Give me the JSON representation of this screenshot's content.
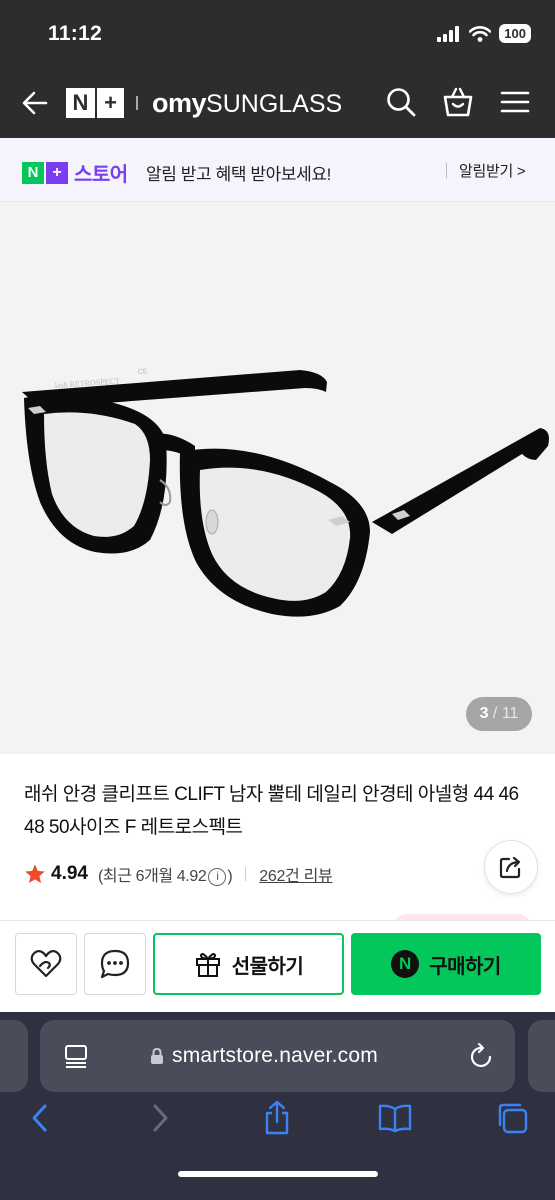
{
  "status": {
    "time": "11:12",
    "battery": "100"
  },
  "header": {
    "badge_n": "N",
    "badge_plus": "+",
    "brand_bold": "omy",
    "brand_rest": "SUNGLASS"
  },
  "notification": {
    "store_n": "N",
    "store_plus": "+",
    "store_name": "스토어",
    "message": "알림 받고 혜택 받아보세요!",
    "action": "알림받기 >"
  },
  "product": {
    "image_index": "3",
    "image_separator": " / ",
    "image_total": "11",
    "title": "래쉬 안경 클리프트 CLIFT 남자 뿔테 데일리 안경테 아넬형 44 46 48 50사이즈 F 레트로스펙트",
    "rating": "4.94",
    "recent_rating_prefix": "(최근 6개월 4.92",
    "recent_rating_suffix": ")",
    "info_mark": "i",
    "reviews": "262건 리뷰",
    "frame_temple_text": "lash  RETROSPECT",
    "frame_ce_text": "CE"
  },
  "actions": {
    "gift_label": "선물하기",
    "buy_n": "N",
    "buy_label": "구매하기"
  },
  "browser": {
    "url": "smartstore.naver.com"
  },
  "colors": {
    "naver_green": "#03c75a",
    "naver_plus_purple": "#7a3ef0",
    "header_dark": "#2b2d2e",
    "browser_chrome": "#2f3140",
    "ios_blue": "#3b82f6"
  }
}
